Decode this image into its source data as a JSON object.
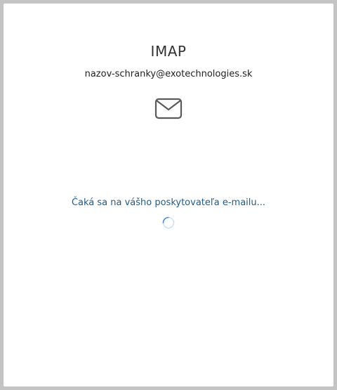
{
  "dialog": {
    "title": "IMAP",
    "email": "nazov-schranky@exotechnologies.sk",
    "icon": "envelope-icon",
    "status_text": "Čaká sa na vášho poskytovateľa e-mailu...",
    "spinner_icon": "loading-spinner-icon",
    "colors": {
      "status_text": "#1f5b8a",
      "spinner": "#4a90d9",
      "background": "#c4c4c4"
    }
  }
}
